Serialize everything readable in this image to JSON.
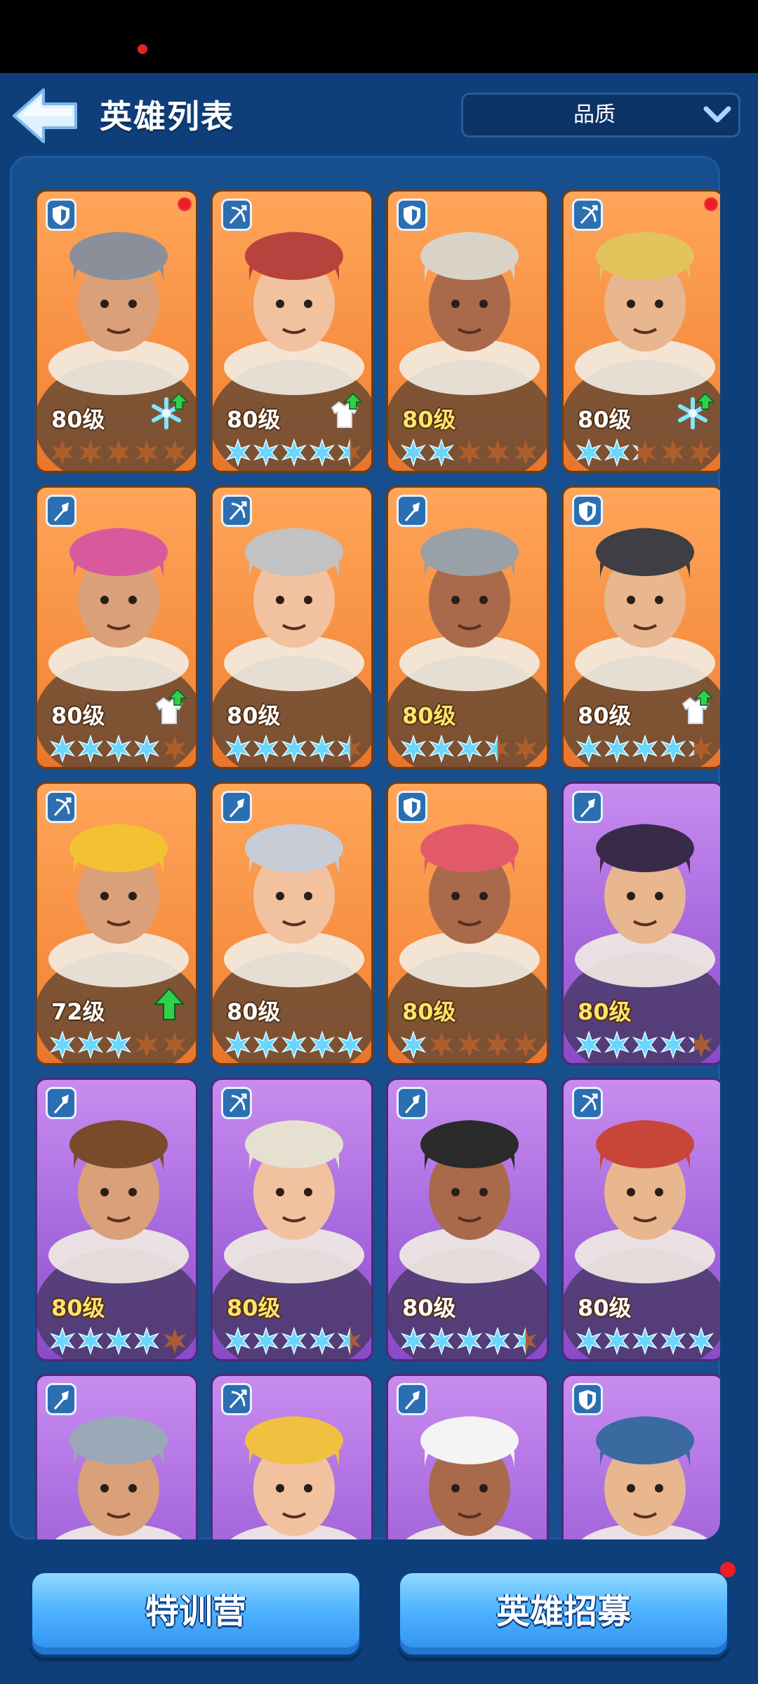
{
  "header": {
    "title": "英雄列表",
    "filter": {
      "selected": "品质"
    }
  },
  "heroes": [
    {
      "level": "80级",
      "stars": [
        0,
        0,
        0,
        0,
        0
      ],
      "class": "shield",
      "rarity": "orange",
      "red_dot": true,
      "upgrade": "snowflake",
      "level_color": "white"
    },
    {
      "level": "80级",
      "stars": [
        1,
        1,
        1,
        1,
        0.5
      ],
      "class": "bow",
      "rarity": "orange",
      "red_dot": false,
      "upgrade": "coat",
      "level_color": "white"
    },
    {
      "level": "80级",
      "stars": [
        1,
        1,
        0,
        0,
        0
      ],
      "class": "shield",
      "rarity": "orange",
      "red_dot": false,
      "upgrade": "none",
      "level_color": "gold"
    },
    {
      "level": "80级",
      "stars": [
        1,
        1,
        0.25,
        0,
        0
      ],
      "class": "bow",
      "rarity": "orange",
      "red_dot": true,
      "upgrade": "snowflake",
      "level_color": "white"
    },
    {
      "level": "80级",
      "stars": [
        1,
        1,
        1,
        1,
        0
      ],
      "class": "spear",
      "rarity": "orange",
      "red_dot": false,
      "upgrade": "coat",
      "level_color": "white"
    },
    {
      "level": "80级",
      "stars": [
        1,
        1,
        1,
        1,
        0.5
      ],
      "class": "bow",
      "rarity": "orange",
      "red_dot": false,
      "upgrade": "none",
      "level_color": "white"
    },
    {
      "level": "80级",
      "stars": [
        1,
        1,
        1,
        0.5,
        0
      ],
      "class": "spear",
      "rarity": "orange",
      "red_dot": false,
      "upgrade": "none",
      "level_color": "gold"
    },
    {
      "level": "80级",
      "stars": [
        1,
        1,
        1,
        1,
        0.25
      ],
      "class": "shield",
      "rarity": "orange",
      "red_dot": false,
      "upgrade": "coat",
      "level_color": "white"
    },
    {
      "level": "72级",
      "stars": [
        1,
        1,
        1,
        0,
        0
      ],
      "class": "bow",
      "rarity": "orange",
      "red_dot": false,
      "upgrade": "arrow",
      "level_color": "white"
    },
    {
      "level": "80级",
      "stars": [
        1,
        1,
        1,
        1,
        1
      ],
      "class": "spear",
      "rarity": "orange",
      "red_dot": false,
      "upgrade": "none",
      "level_color": "white"
    },
    {
      "level": "80级",
      "stars": [
        1,
        0,
        0,
        0,
        0
      ],
      "class": "shield",
      "rarity": "orange",
      "red_dot": false,
      "upgrade": "none",
      "level_color": "gold"
    },
    {
      "level": "80级",
      "stars": [
        1,
        1,
        1,
        1,
        0.25
      ],
      "class": "spear",
      "rarity": "purple",
      "red_dot": false,
      "upgrade": "none",
      "level_color": "gold"
    },
    {
      "level": "80级",
      "stars": [
        1,
        1,
        1,
        1,
        0
      ],
      "class": "spear",
      "rarity": "purple",
      "red_dot": false,
      "upgrade": "none",
      "level_color": "gold"
    },
    {
      "level": "80级",
      "stars": [
        1,
        1,
        1,
        1,
        0.5
      ],
      "class": "bow",
      "rarity": "purple",
      "red_dot": false,
      "upgrade": "none",
      "level_color": "gold"
    },
    {
      "level": "80级",
      "stars": [
        1,
        1,
        1,
        1,
        0.5
      ],
      "class": "spear",
      "rarity": "purple",
      "red_dot": false,
      "upgrade": "none",
      "level_color": "white"
    },
    {
      "level": "80级",
      "stars": [
        1,
        1,
        1,
        1,
        1
      ],
      "class": "bow",
      "rarity": "purple",
      "red_dot": false,
      "upgrade": "none",
      "level_color": "white"
    },
    {
      "level": "",
      "stars": [],
      "class": "spear",
      "rarity": "purple",
      "red_dot": false,
      "upgrade": "none",
      "level_color": "white"
    },
    {
      "level": "",
      "stars": [],
      "class": "bow",
      "rarity": "purple",
      "red_dot": false,
      "upgrade": "none",
      "level_color": "white"
    },
    {
      "level": "",
      "stars": [],
      "class": "spear",
      "rarity": "purple",
      "red_dot": false,
      "upgrade": "none",
      "level_color": "white"
    },
    {
      "level": "",
      "stars": [],
      "class": "shield",
      "rarity": "purple",
      "red_dot": false,
      "upgrade": "none",
      "level_color": "white"
    }
  ],
  "footer": {
    "training_label": "特训营",
    "recruit_label": "英雄招募"
  },
  "colors": {
    "star_filled": "#69d6ff",
    "star_empty": "#b5622a",
    "upgrade_green": "#2fd14a"
  }
}
